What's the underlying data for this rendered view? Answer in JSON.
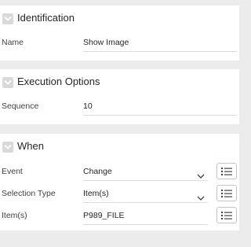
{
  "sections": {
    "identification": {
      "title": "Identification",
      "fields": {
        "name": {
          "label": "Name",
          "value": "Show Image"
        }
      }
    },
    "execution": {
      "title": "Execution Options",
      "fields": {
        "sequence": {
          "label": "Sequence",
          "value": "10"
        }
      }
    },
    "when": {
      "title": "When",
      "fields": {
        "event": {
          "label": "Event",
          "value": "Change"
        },
        "selection_type": {
          "label": "Selection Type",
          "value": "Item(s)"
        },
        "items": {
          "label": "Item(s)",
          "value": "P989_FILE"
        }
      }
    }
  },
  "icons": {
    "collapse": "chevron-down-icon",
    "select": "chevron-down-icon",
    "list": "list-icon"
  },
  "colors": {
    "background": "#ececec",
    "panel": "#ffffff",
    "chevron_box": "#d9d9d9"
  }
}
